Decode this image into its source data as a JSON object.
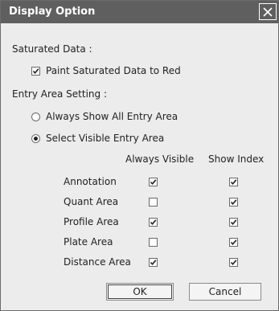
{
  "title": "Display Option",
  "saturated": {
    "section_label": "Saturated Data :",
    "paint_label": "Paint Saturated Data to Red",
    "paint_checked": true
  },
  "entry": {
    "section_label": "Entry Area Setting :",
    "radio_all_label": "Always Show All Entry Area",
    "radio_select_label": "Select Visible Entry Area",
    "selected": "select"
  },
  "table": {
    "col_visible": "Always Visible",
    "col_index": "Show Index",
    "rows": [
      {
        "label": "Annotation",
        "always_visible": true,
        "show_index": true
      },
      {
        "label": "Quant Area",
        "always_visible": false,
        "show_index": true
      },
      {
        "label": "Profile Area",
        "always_visible": true,
        "show_index": true
      },
      {
        "label": "Plate Area",
        "always_visible": false,
        "show_index": true
      },
      {
        "label": "Distance Area",
        "always_visible": true,
        "show_index": true
      }
    ]
  },
  "buttons": {
    "ok": "OK",
    "cancel": "Cancel"
  }
}
